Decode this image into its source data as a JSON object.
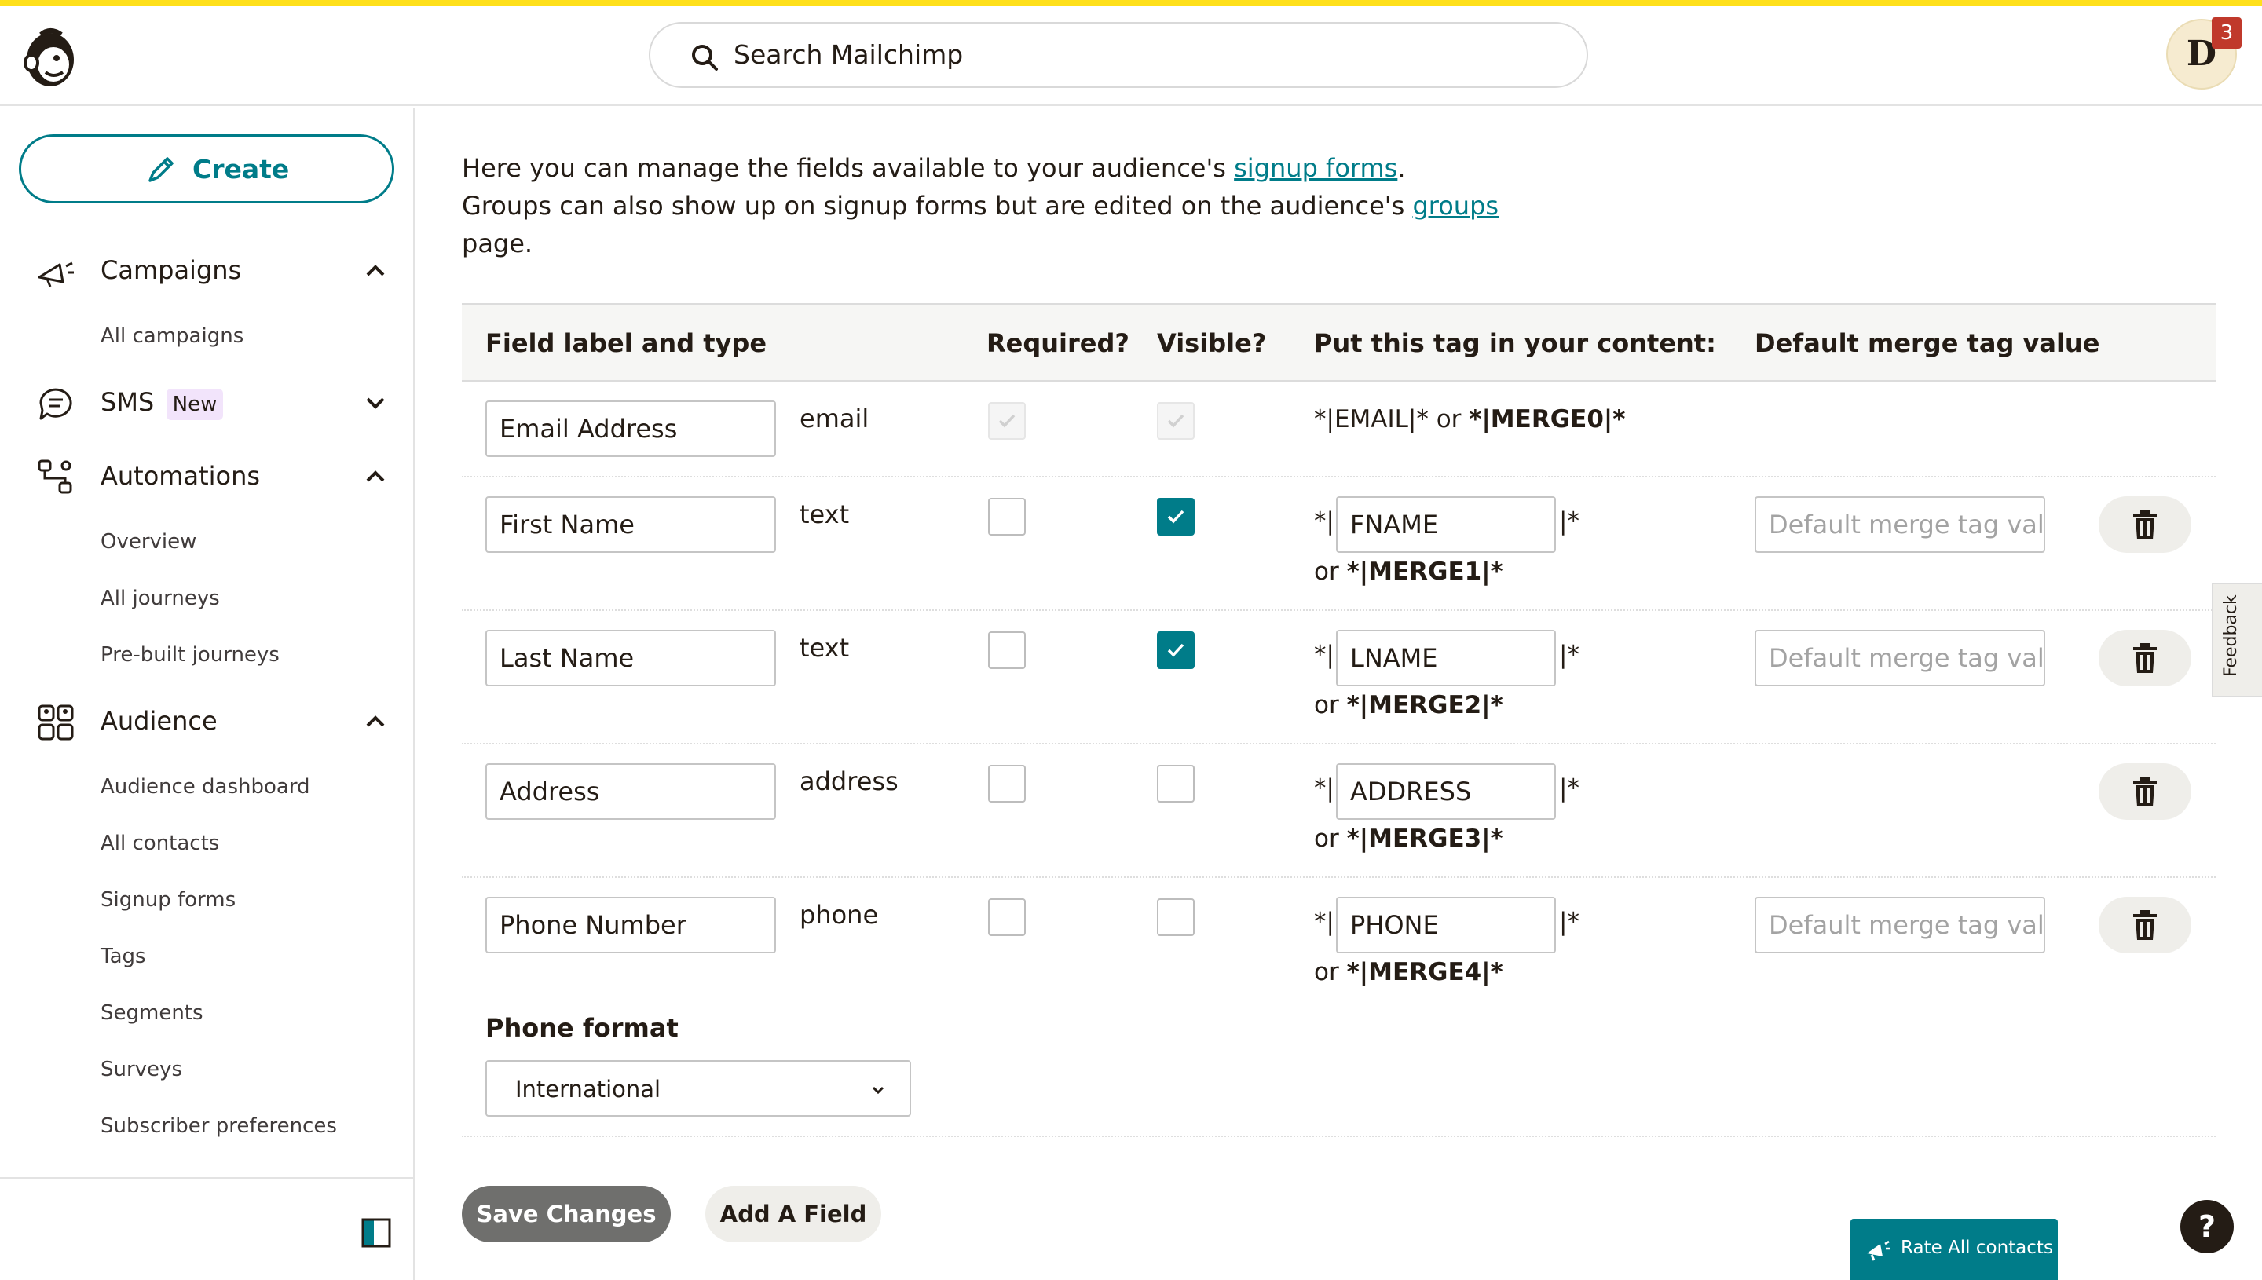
{
  "header": {
    "search_placeholder": "Search Mailchimp",
    "avatar_letter": "D",
    "notification_count": "3"
  },
  "sidebar": {
    "create_label": "Create",
    "campaigns": {
      "label": "Campaigns",
      "items": [
        "All campaigns"
      ]
    },
    "sms": {
      "label": "SMS",
      "badge": "New"
    },
    "automations": {
      "label": "Automations",
      "items": [
        "Overview",
        "All journeys",
        "Pre-built journeys"
      ]
    },
    "audience": {
      "label": "Audience",
      "items": [
        "Audience dashboard",
        "All contacts",
        "Signup forms",
        "Tags",
        "Segments",
        "Surveys",
        "Subscriber preferences"
      ]
    }
  },
  "intro": {
    "line1_pre": "Here you can manage the fields available to your audience's ",
    "line1_link": "signup forms",
    "line1_post": ".",
    "line2_pre": "Groups can also show up on signup forms but are edited on the audience's ",
    "line2_link": "groups",
    "line3": "page."
  },
  "table": {
    "headers": {
      "field": "Field label and type",
      "required": "Required?",
      "visible": "Visible?",
      "tag": "Put this tag in your content:",
      "default": "Default merge tag value"
    },
    "tag_prefix": "*|",
    "tag_suffix": "|*",
    "or_text": "or",
    "default_placeholder": "Default merge tag value",
    "rows": [
      {
        "label": "Email Address",
        "type": "email",
        "required": true,
        "visible": true,
        "locked": true,
        "static_tag_pre": "*|EMAIL|* or ",
        "static_tag_bold": "*|MERGE0|*"
      },
      {
        "label": "First Name",
        "type": "text",
        "required": false,
        "visible": true,
        "tag": "FNAME",
        "merge": "*|MERGE1|*"
      },
      {
        "label": "Last Name",
        "type": "text",
        "required": false,
        "visible": true,
        "tag": "LNAME",
        "merge": "*|MERGE2|*"
      },
      {
        "label": "Address",
        "type": "address",
        "required": false,
        "visible": false,
        "tag": "ADDRESS",
        "merge": "*|MERGE3|*"
      },
      {
        "label": "Phone Number",
        "type": "phone",
        "required": false,
        "visible": false,
        "tag": "PHONE",
        "merge": "*|MERGE4|*"
      }
    ]
  },
  "phone_format": {
    "label": "Phone format",
    "selected": "International"
  },
  "actions": {
    "save": "Save Changes",
    "add_field": "Add A Field"
  },
  "feedback_label": "Feedback",
  "rate_label": "Rate All contacts",
  "help_label": "?",
  "colors": {
    "accent_teal": "#007c89",
    "brand_yellow": "#ffe01b",
    "text_dark": "#241c15"
  }
}
